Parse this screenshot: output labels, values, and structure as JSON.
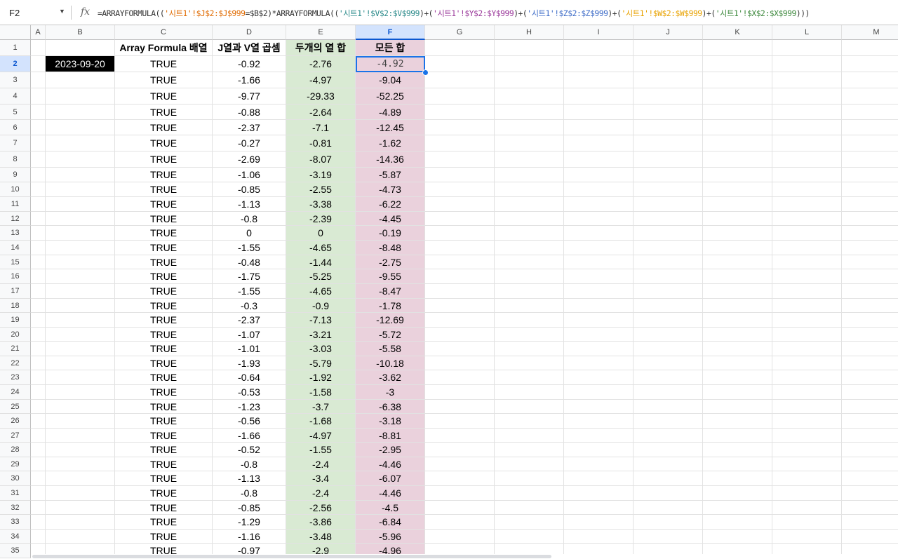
{
  "name_box": "F2",
  "formula_icon": "fx",
  "formula_parts": [
    {
      "t": "=ARRAYFORMULA((",
      "c": "pl"
    },
    {
      "t": "'시트1'!$J$2:$J$999",
      "c": "s1"
    },
    {
      "t": "=$B$2)*ARRAYFORMULA((",
      "c": "pl"
    },
    {
      "t": "'시트1'!$V$2:$V$999",
      "c": "s2"
    },
    {
      "t": ")+(",
      "c": "pl"
    },
    {
      "t": "'시트1'!$Y$2:$Y$999",
      "c": "s3"
    },
    {
      "t": ")+(",
      "c": "pl"
    },
    {
      "t": "'시트1'!$Z$2:$Z$999",
      "c": "s4"
    },
    {
      "t": ")+(",
      "c": "pl"
    },
    {
      "t": "'시트1'!$W$2:$W$999",
      "c": "s5"
    },
    {
      "t": ")+(",
      "c": "pl"
    },
    {
      "t": "'시트1'!$X$2:$X$999",
      "c": "s6"
    },
    {
      "t": ")))",
      "c": "pl"
    }
  ],
  "columns": [
    "A",
    "B",
    "C",
    "D",
    "E",
    "F",
    "G",
    "H",
    "I",
    "J",
    "K",
    "L",
    "M"
  ],
  "selected_column": "F",
  "selected_row": 2,
  "headers": {
    "C": "Array Formula 배열",
    "D": "J열과 V열 곱셈",
    "E": "두개의 열 합",
    "F": "모든 합"
  },
  "date_cell": "2023-09-20",
  "colors": {
    "col_e_fill": "#d9ead3",
    "col_f_fill": "#ead1dc",
    "date_fill": "#000000",
    "selection": "#1a73e8"
  },
  "rows": [
    {
      "n": 2,
      "c": "TRUE",
      "d": "-0.92",
      "e": "-2.76",
      "f": "-4.92"
    },
    {
      "n": 3,
      "c": "TRUE",
      "d": "-1.66",
      "e": "-4.97",
      "f": "-9.04"
    },
    {
      "n": 4,
      "c": "TRUE",
      "d": "-9.77",
      "e": "-29.33",
      "f": "-52.25"
    },
    {
      "n": 5,
      "c": "TRUE",
      "d": "-0.88",
      "e": "-2.64",
      "f": "-4.89"
    },
    {
      "n": 6,
      "c": "TRUE",
      "d": "-2.37",
      "e": "-7.1",
      "f": "-12.45"
    },
    {
      "n": 7,
      "c": "TRUE",
      "d": "-0.27",
      "e": "-0.81",
      "f": "-1.62"
    },
    {
      "n": 8,
      "c": "TRUE",
      "d": "-2.69",
      "e": "-8.07",
      "f": "-14.36"
    },
    {
      "n": 9,
      "c": "TRUE",
      "d": "-1.06",
      "e": "-3.19",
      "f": "-5.87"
    },
    {
      "n": 10,
      "c": "TRUE",
      "d": "-0.85",
      "e": "-2.55",
      "f": "-4.73"
    },
    {
      "n": 11,
      "c": "TRUE",
      "d": "-1.13",
      "e": "-3.38",
      "f": "-6.22"
    },
    {
      "n": 12,
      "c": "TRUE",
      "d": "-0.8",
      "e": "-2.39",
      "f": "-4.45"
    },
    {
      "n": 13,
      "c": "TRUE",
      "d": "0",
      "e": "0",
      "f": "-0.19"
    },
    {
      "n": 14,
      "c": "TRUE",
      "d": "-1.55",
      "e": "-4.65",
      "f": "-8.48"
    },
    {
      "n": 15,
      "c": "TRUE",
      "d": "-0.48",
      "e": "-1.44",
      "f": "-2.75"
    },
    {
      "n": 16,
      "c": "TRUE",
      "d": "-1.75",
      "e": "-5.25",
      "f": "-9.55"
    },
    {
      "n": 17,
      "c": "TRUE",
      "d": "-1.55",
      "e": "-4.65",
      "f": "-8.47"
    },
    {
      "n": 18,
      "c": "TRUE",
      "d": "-0.3",
      "e": "-0.9",
      "f": "-1.78"
    },
    {
      "n": 19,
      "c": "TRUE",
      "d": "-2.37",
      "e": "-7.13",
      "f": "-12.69"
    },
    {
      "n": 20,
      "c": "TRUE",
      "d": "-1.07",
      "e": "-3.21",
      "f": "-5.72"
    },
    {
      "n": 21,
      "c": "TRUE",
      "d": "-1.01",
      "e": "-3.03",
      "f": "-5.58"
    },
    {
      "n": 22,
      "c": "TRUE",
      "d": "-1.93",
      "e": "-5.79",
      "f": "-10.18"
    },
    {
      "n": 23,
      "c": "TRUE",
      "d": "-0.64",
      "e": "-1.92",
      "f": "-3.62"
    },
    {
      "n": 24,
      "c": "TRUE",
      "d": "-0.53",
      "e": "-1.58",
      "f": "-3"
    },
    {
      "n": 25,
      "c": "TRUE",
      "d": "-1.23",
      "e": "-3.7",
      "f": "-6.38"
    },
    {
      "n": 26,
      "c": "TRUE",
      "d": "-0.56",
      "e": "-1.68",
      "f": "-3.18"
    },
    {
      "n": 27,
      "c": "TRUE",
      "d": "-1.66",
      "e": "-4.97",
      "f": "-8.81"
    },
    {
      "n": 28,
      "c": "TRUE",
      "d": "-0.52",
      "e": "-1.55",
      "f": "-2.95"
    },
    {
      "n": 29,
      "c": "TRUE",
      "d": "-0.8",
      "e": "-2.4",
      "f": "-4.46"
    },
    {
      "n": 30,
      "c": "TRUE",
      "d": "-1.13",
      "e": "-3.4",
      "f": "-6.07"
    },
    {
      "n": 31,
      "c": "TRUE",
      "d": "-0.8",
      "e": "-2.4",
      "f": "-4.46"
    },
    {
      "n": 32,
      "c": "TRUE",
      "d": "-0.85",
      "e": "-2.56",
      "f": "-4.5"
    },
    {
      "n": 33,
      "c": "TRUE",
      "d": "-1.29",
      "e": "-3.86",
      "f": "-6.84"
    },
    {
      "n": 34,
      "c": "TRUE",
      "d": "-1.16",
      "e": "-3.48",
      "f": "-5.96"
    },
    {
      "n": 35,
      "c": "TRUE",
      "d": "-0.97",
      "e": "-2.9",
      "f": "-4.96"
    }
  ]
}
